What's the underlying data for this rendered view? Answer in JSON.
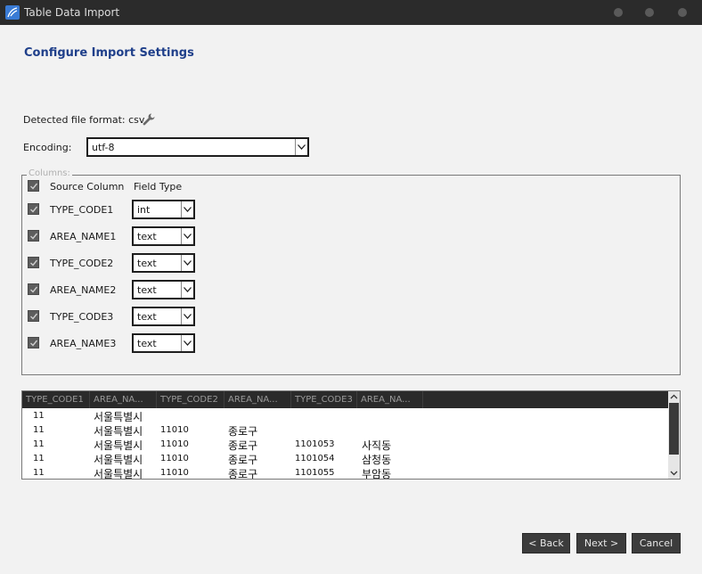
{
  "window": {
    "title": "Table Data Import",
    "icon": "mysql-workbench-icon"
  },
  "page": {
    "heading": "Configure Import Settings",
    "detected_format": "Detected file format: csv",
    "encoding_label": "Encoding:",
    "encoding_value": "utf-8",
    "columns_legend": "Columns:",
    "header_source": "Source Column",
    "header_type": "Field Type"
  },
  "columns": [
    {
      "name": "TYPE_CODE1",
      "type": "int",
      "checked": true
    },
    {
      "name": "AREA_NAME1",
      "type": "text",
      "checked": true
    },
    {
      "name": "TYPE_CODE2",
      "type": "text",
      "checked": true
    },
    {
      "name": "AREA_NAME2",
      "type": "text",
      "checked": true
    },
    {
      "name": "TYPE_CODE3",
      "type": "text",
      "checked": true
    },
    {
      "name": "AREA_NAME3",
      "type": "text",
      "checked": true
    }
  ],
  "preview": {
    "headers": [
      "TYPE_CODE1",
      "AREA_NA...",
      "TYPE_CODE2",
      "AREA_NA...",
      "TYPE_CODE3",
      "AREA_NA..."
    ],
    "rows": [
      [
        "11",
        "서울특별시",
        "",
        "",
        "",
        ""
      ],
      [
        "11",
        "서울특별시",
        "11010",
        "종로구",
        "",
        ""
      ],
      [
        "11",
        "서울특별시",
        "11010",
        "종로구",
        "1101053",
        "사직동"
      ],
      [
        "11",
        "서울특별시",
        "11010",
        "종로구",
        "1101054",
        "삼청동"
      ],
      [
        "11",
        "서울특별시",
        "11010",
        "종로구",
        "1101055",
        "부암동"
      ]
    ]
  },
  "buttons": {
    "back": "< Back",
    "next": "Next >",
    "cancel": "Cancel"
  },
  "colors": {
    "heading": "#1f3f8a",
    "titlebar": "#2b2b2b",
    "button": "#3c3c3c"
  }
}
